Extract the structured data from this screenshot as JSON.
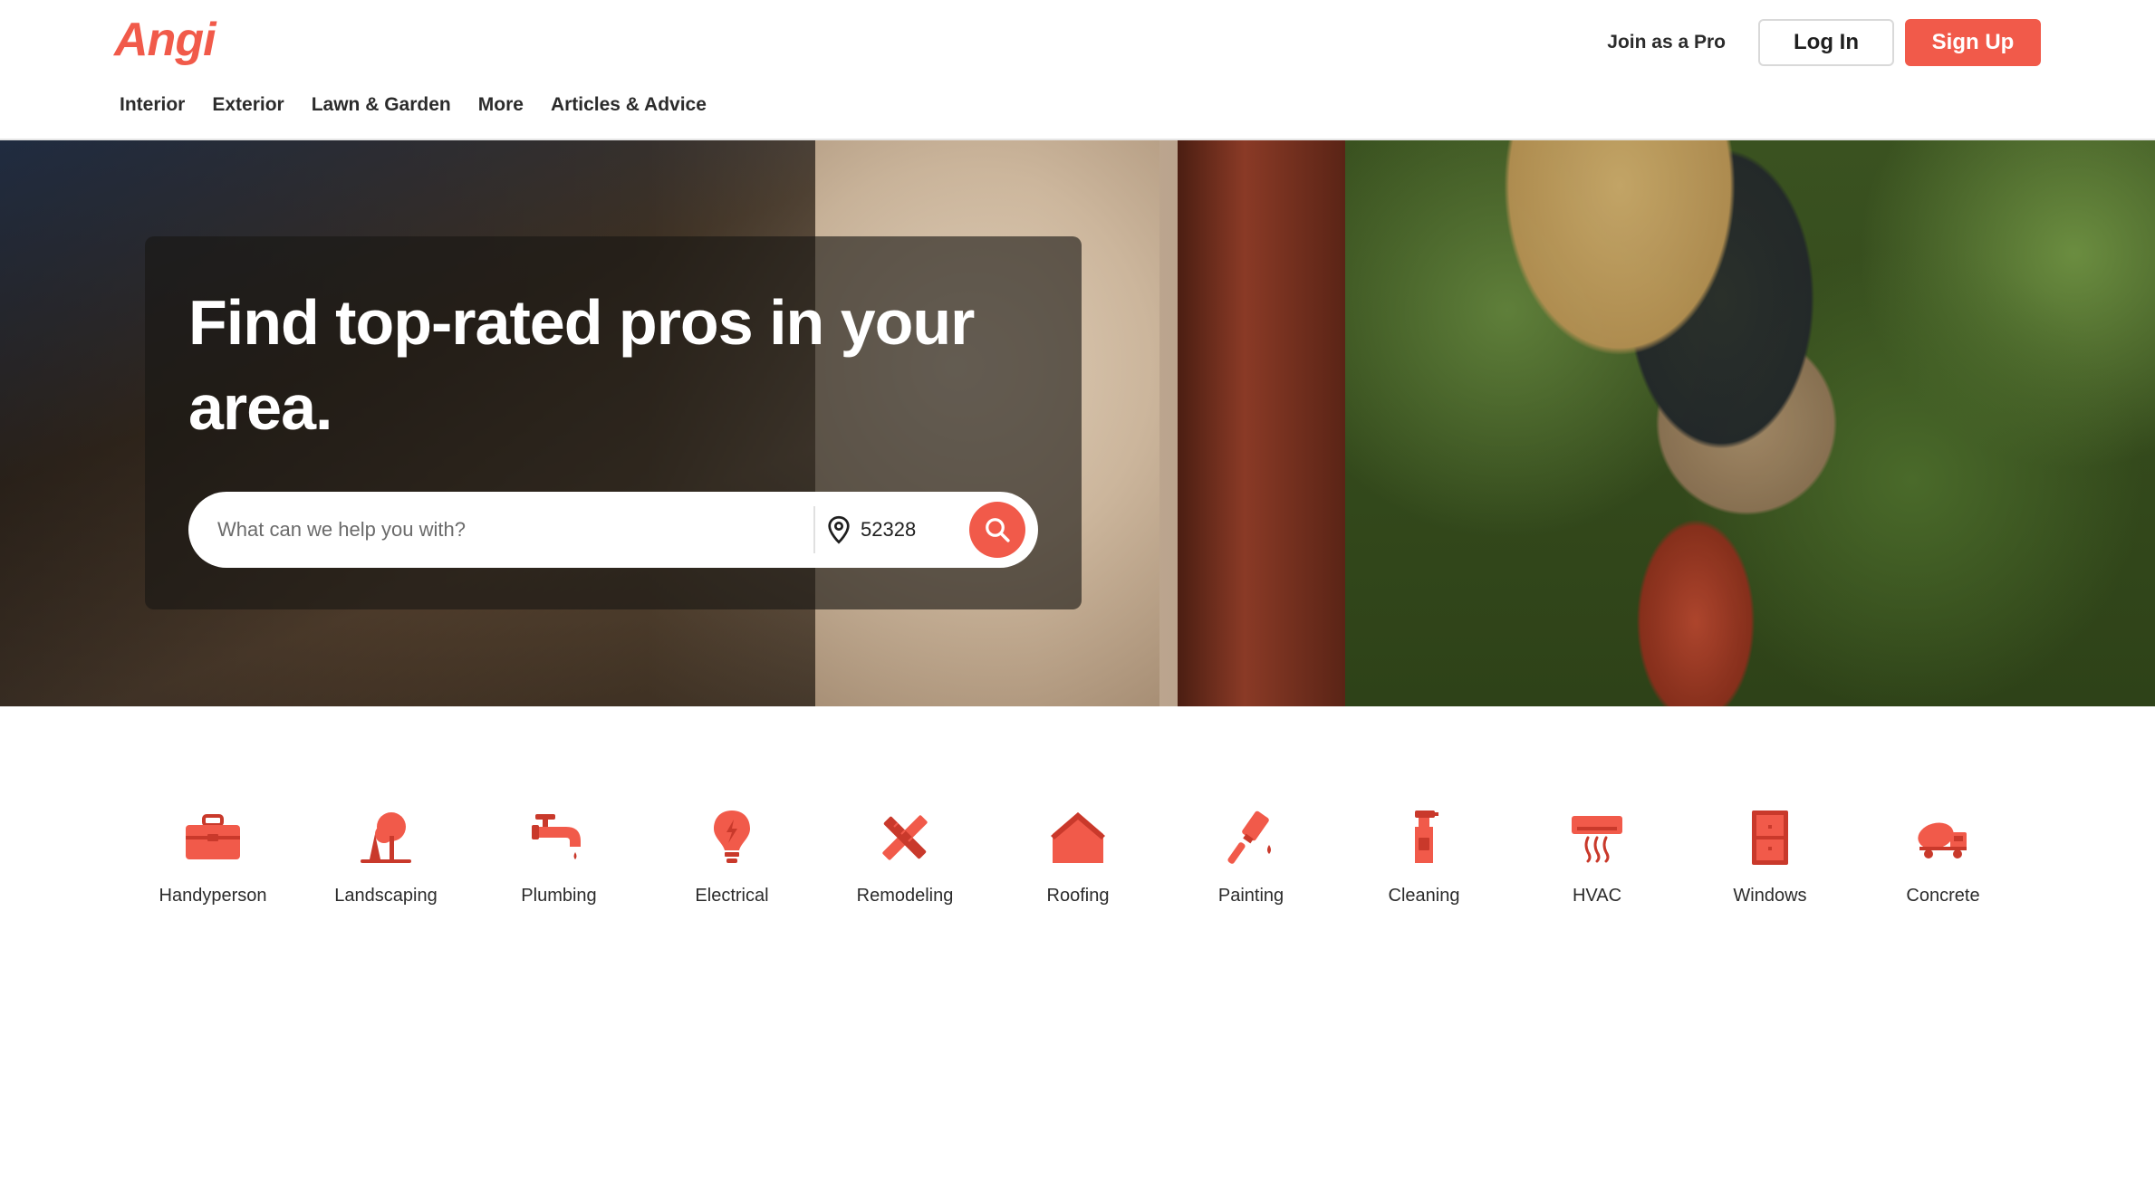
{
  "header": {
    "logo": "Angi",
    "nav": [
      "Interior",
      "Exterior",
      "Lawn & Garden",
      "More",
      "Articles & Advice"
    ],
    "join_pro": "Join as a Pro",
    "login": "Log In",
    "signup": "Sign Up"
  },
  "hero": {
    "title": "Find top-rated pros in your area.",
    "search_placeholder": "What can we help you with?",
    "zip": "52328"
  },
  "categories": [
    {
      "label": "Handyperson",
      "icon": "toolbox-icon"
    },
    {
      "label": "Landscaping",
      "icon": "tree-icon"
    },
    {
      "label": "Plumbing",
      "icon": "faucet-icon"
    },
    {
      "label": "Electrical",
      "icon": "lightbulb-icon"
    },
    {
      "label": "Remodeling",
      "icon": "ruler-pencil-icon"
    },
    {
      "label": "Roofing",
      "icon": "house-icon"
    },
    {
      "label": "Painting",
      "icon": "paintbrush-icon"
    },
    {
      "label": "Cleaning",
      "icon": "spray-bottle-icon"
    },
    {
      "label": "HVAC",
      "icon": "air-conditioner-icon"
    },
    {
      "label": "Windows",
      "icon": "window-icon"
    },
    {
      "label": "Concrete",
      "icon": "cement-mixer-icon"
    }
  ],
  "colors": {
    "brand": "#f15a4a",
    "brand_dark": "#c9392b"
  }
}
